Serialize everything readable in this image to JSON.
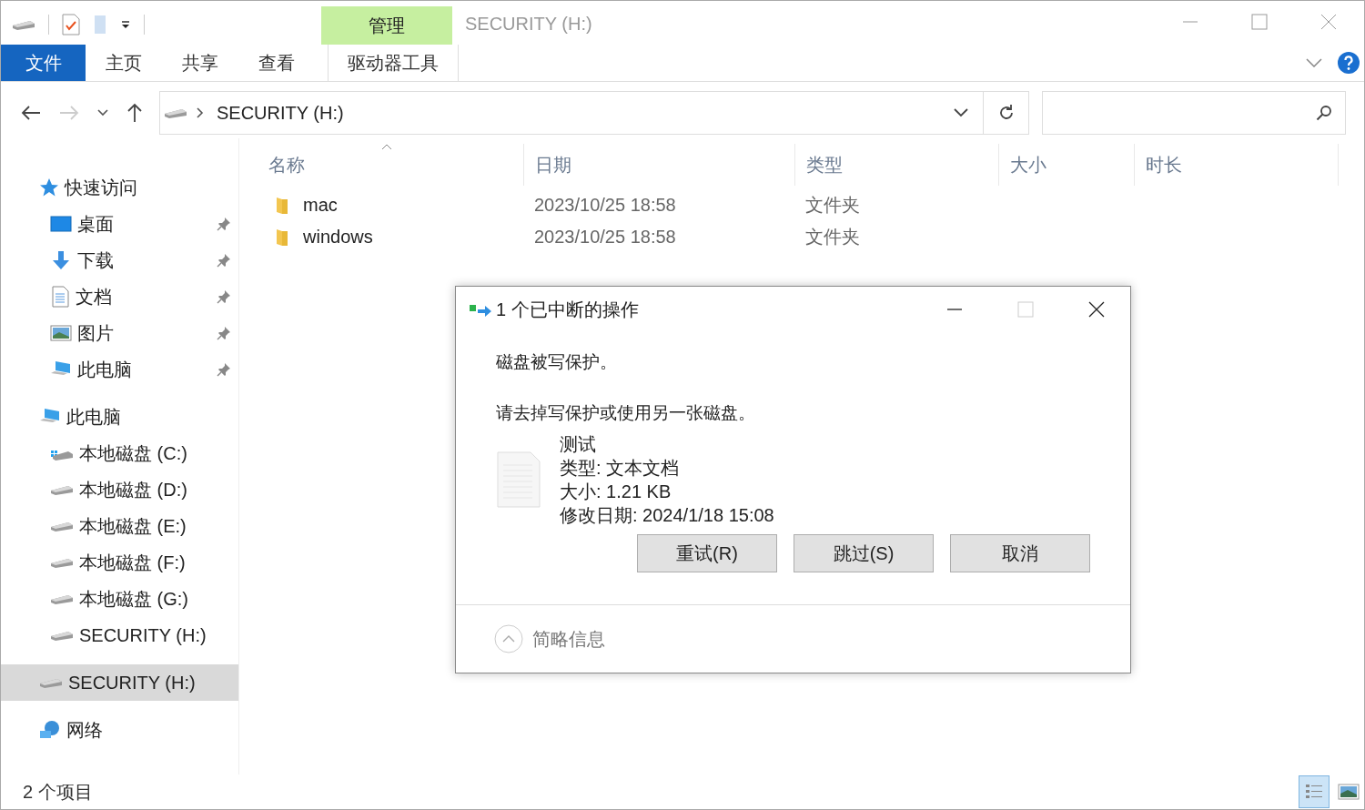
{
  "window": {
    "title": "SECURITY (H:)"
  },
  "ribbon": {
    "tabs": [
      {
        "label": "文件",
        "kind": "file"
      },
      {
        "label": "主页",
        "kind": "plain"
      },
      {
        "label": "共享",
        "kind": "plain"
      },
      {
        "label": "查看",
        "kind": "plain"
      },
      {
        "label": "驱动器工具",
        "kind": "context",
        "group": "管理"
      }
    ]
  },
  "address": {
    "path": "SECURITY (H:)"
  },
  "sidebar": {
    "items": [
      {
        "label": "快速访问",
        "kind": "star",
        "selected": false,
        "children": [
          {
            "label": "桌面",
            "kind": "desktop",
            "pinned": true,
            "selected": false
          },
          {
            "label": "下载",
            "kind": "download",
            "pinned": true,
            "selected": false
          },
          {
            "label": "文档",
            "kind": "doc",
            "pinned": true,
            "selected": false
          },
          {
            "label": "图片",
            "kind": "picture",
            "pinned": true,
            "selected": false
          },
          {
            "label": "此电脑",
            "kind": "pc",
            "pinned": true,
            "selected": false
          }
        ]
      },
      {
        "label": "此电脑",
        "kind": "pc",
        "selected": false,
        "children": [
          {
            "label": "本地磁盘 (C:)",
            "kind": "drive-win",
            "pinned": false,
            "selected": false
          },
          {
            "label": "本地磁盘 (D:)",
            "kind": "drive",
            "pinned": false,
            "selected": false
          },
          {
            "label": "本地磁盘 (E:)",
            "kind": "drive",
            "pinned": false,
            "selected": false
          },
          {
            "label": "本地磁盘 (F:)",
            "kind": "drive",
            "pinned": false,
            "selected": false
          },
          {
            "label": "本地磁盘 (G:)",
            "kind": "drive",
            "pinned": false,
            "selected": false
          },
          {
            "label": "SECURITY (H:)",
            "kind": "drive",
            "pinned": false,
            "selected": false
          }
        ]
      },
      {
        "label": "SECURITY (H:)",
        "kind": "drive",
        "selected": true
      },
      {
        "label": "网络",
        "kind": "network",
        "selected": false
      }
    ]
  },
  "table": {
    "columns": [
      {
        "label": "名称",
        "sorted": true
      },
      {
        "label": "日期",
        "sorted": false
      },
      {
        "label": "类型",
        "sorted": false
      },
      {
        "label": "大小",
        "sorted": false
      },
      {
        "label": "时长",
        "sorted": false
      }
    ],
    "rows": [
      {
        "name": "mac",
        "date": "2023/10/25 18:58",
        "type": "文件夹"
      },
      {
        "name": "windows",
        "date": "2023/10/25 18:58",
        "type": "文件夹"
      }
    ]
  },
  "dialog": {
    "title": "1 个已中断的操作",
    "message": "磁盘被写保护。",
    "hint": "请去掉写保护或使用另一张磁盘。",
    "file": {
      "name": "测试",
      "type": "类型: 文本文档",
      "size": "大小: 1.21 KB",
      "modified": "修改日期: 2024/1/18 15:08"
    },
    "buttons": [
      "重试(R)",
      "跳过(S)",
      "取消"
    ],
    "details_toggle": "简略信息",
    "maximize_disabled": true
  },
  "status_bar": {
    "count": "2 个项目",
    "views": [
      {
        "kind": "details",
        "selected": true
      },
      {
        "kind": "large",
        "selected": false
      }
    ]
  }
}
